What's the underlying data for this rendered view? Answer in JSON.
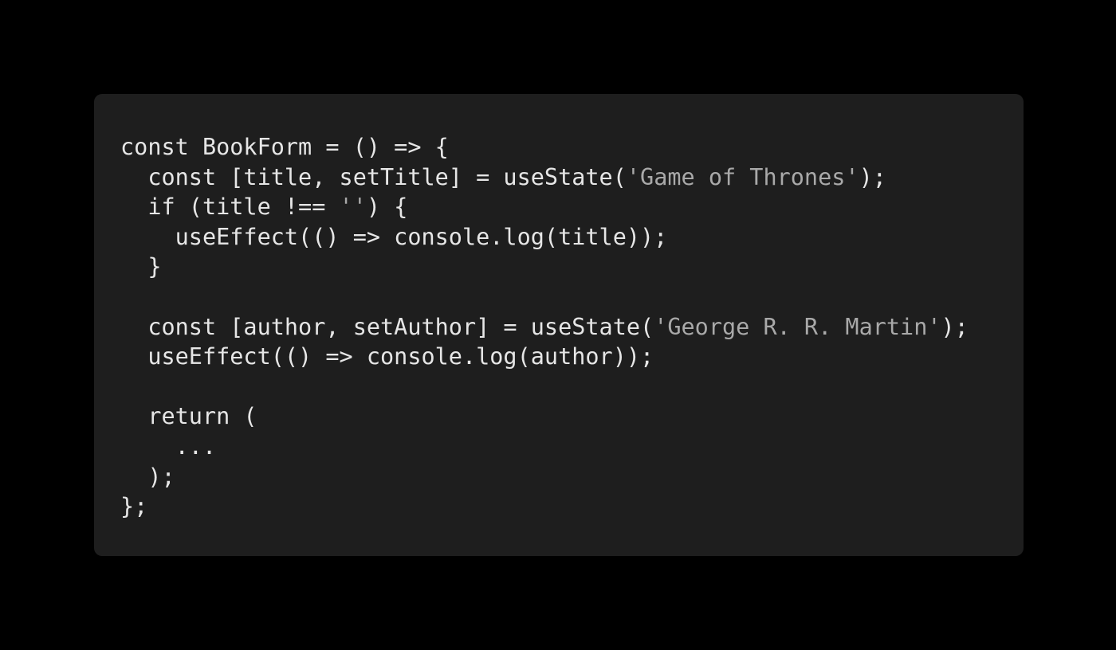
{
  "colors": {
    "background": "#000000",
    "card": "#1e1e1e",
    "text": "#e6e6e6",
    "string": "#a9a9a9"
  },
  "code": {
    "lines": [
      [
        {
          "t": "const BookForm = () => {",
          "k": "code"
        }
      ],
      [
        {
          "t": "  const [title, setTitle] = useState(",
          "k": "code"
        },
        {
          "t": "'Game of Thrones'",
          "k": "str"
        },
        {
          "t": ");",
          "k": "code"
        }
      ],
      [
        {
          "t": "  if (title !== ",
          "k": "code"
        },
        {
          "t": "''",
          "k": "str"
        },
        {
          "t": ") {",
          "k": "code"
        }
      ],
      [
        {
          "t": "    useEffect(() => console.log(title));",
          "k": "code"
        }
      ],
      [
        {
          "t": "  }",
          "k": "code"
        }
      ],
      [
        {
          "t": "",
          "k": "code"
        }
      ],
      [
        {
          "t": "  const [author, setAuthor] = useState(",
          "k": "code"
        },
        {
          "t": "'George R. R. Martin'",
          "k": "str"
        },
        {
          "t": ");",
          "k": "code"
        }
      ],
      [
        {
          "t": "  useEffect(() => console.log(author));",
          "k": "code"
        }
      ],
      [
        {
          "t": "",
          "k": "code"
        }
      ],
      [
        {
          "t": "  return (",
          "k": "code"
        }
      ],
      [
        {
          "t": "    ...",
          "k": "code"
        }
      ],
      [
        {
          "t": "  );",
          "k": "code"
        }
      ],
      [
        {
          "t": "};",
          "k": "code"
        }
      ]
    ]
  }
}
